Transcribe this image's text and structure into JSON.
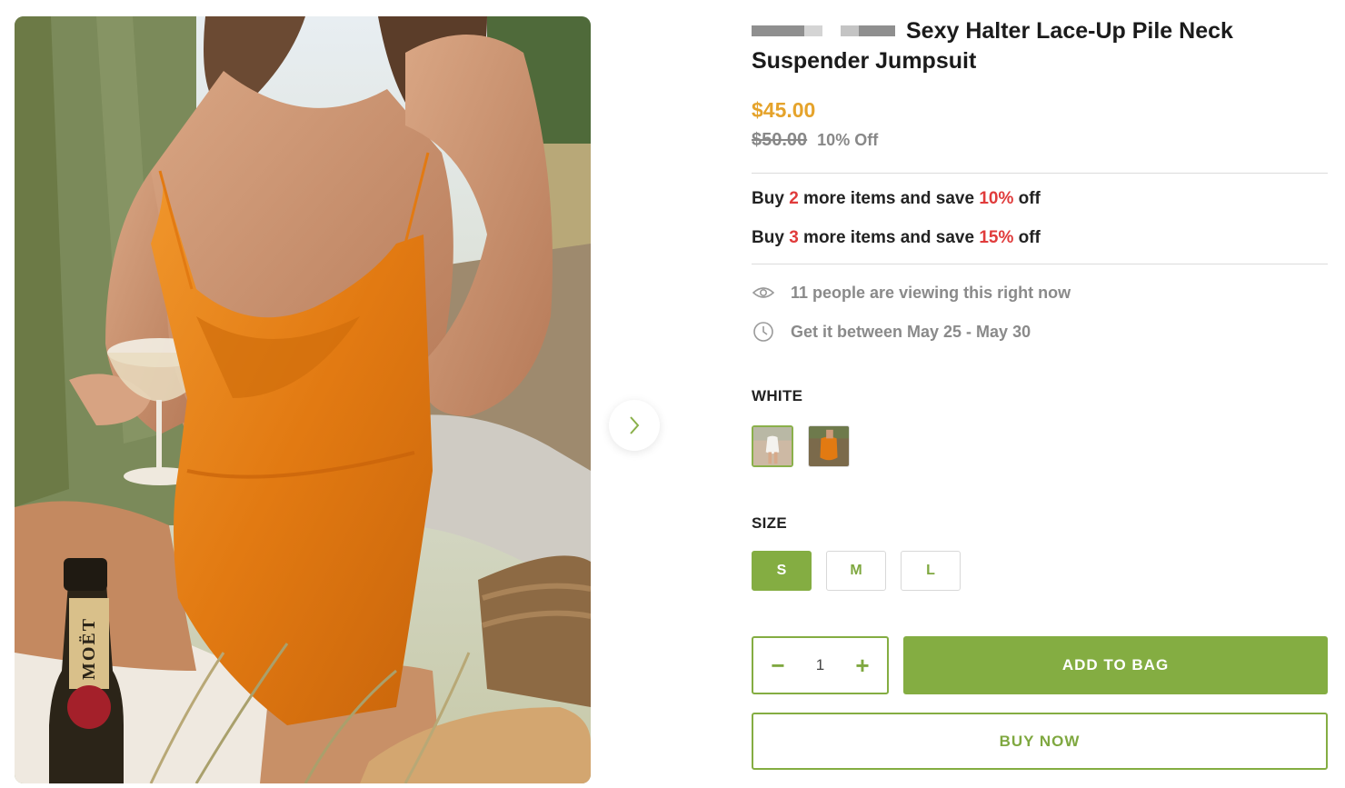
{
  "product": {
    "title": "Sexy Halter Lace-Up Pile Neck Suspender Jumpsuit",
    "price": "$45.00",
    "compare_price": "$50.00",
    "discount": "10% Off"
  },
  "promotions": [
    {
      "prefix": "Buy ",
      "count": "2",
      "middle": " more items and save ",
      "percent": "10%",
      "suffix": " off"
    },
    {
      "prefix": "Buy ",
      "count": "3",
      "middle": " more items and save ",
      "percent": "15%",
      "suffix": " off"
    }
  ],
  "meta": {
    "viewers": {
      "icon": "eye-icon",
      "text": "11 people are viewing this right now"
    },
    "delivery": {
      "icon": "clock-icon",
      "text": "Get it between May 25 - May 30"
    }
  },
  "color": {
    "label": "WHITE",
    "swatches": [
      {
        "name": "white",
        "selected": true
      },
      {
        "name": "orange",
        "selected": false
      }
    ]
  },
  "size": {
    "label": "SIZE",
    "options": [
      "S",
      "M",
      "L"
    ],
    "selected": "S"
  },
  "quantity": {
    "minus": "−",
    "value": "1",
    "plus": "+"
  },
  "actions": {
    "add_to_bag": "ADD TO BAG",
    "buy_now": "BUY NOW"
  },
  "gallery": {
    "next_icon": "chevron-right-icon",
    "bottle_label": "MOËT"
  },
  "colors": {
    "accent": "#84ad42",
    "price": "#e5a32b",
    "promo_red": "#e03b3b",
    "muted": "#888888"
  }
}
